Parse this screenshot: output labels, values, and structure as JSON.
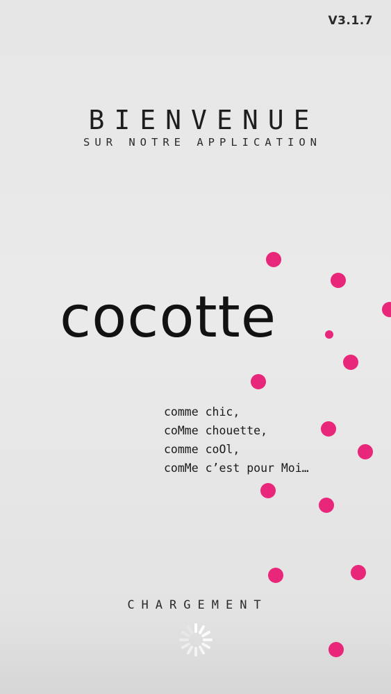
{
  "app": {
    "version": "V3.1.7",
    "welcome_title": "BIENVENUE",
    "welcome_subtitle": "SUR NOTRE APPLICATION",
    "brand_name": "cocotte",
    "tagline": [
      "comme chic,",
      "coMme chouette,",
      "comme coOl,",
      "comMe c’est pour Moi…"
    ],
    "loading_label": "CHARGEMENT"
  },
  "colors": {
    "accent": "#e8267a",
    "text": "#1a1a1a",
    "background": "#e6e6e6"
  },
  "icons": {
    "loader": "loading-spinner-icon",
    "decor": "pink-dot-icon"
  }
}
